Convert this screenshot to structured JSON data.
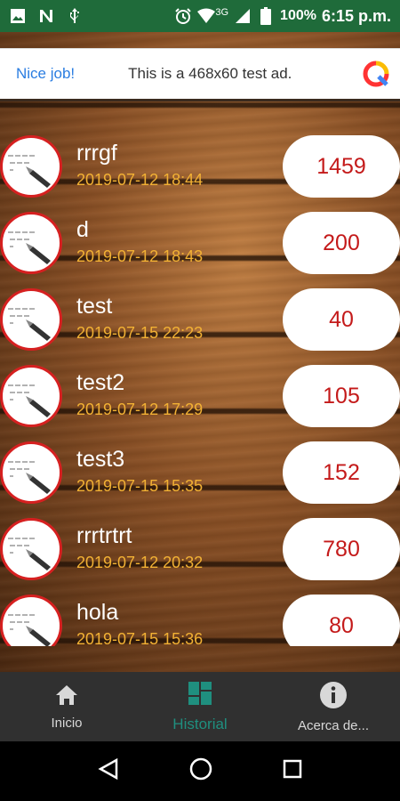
{
  "status_bar": {
    "network": "3G",
    "battery": "100%",
    "time": "6:15 p.m."
  },
  "ad": {
    "nice_label": "Nice job!",
    "text": "This is a 468x60 test ad."
  },
  "history": [
    {
      "name": "rrrgf",
      "date": "2019-07-12 18:44",
      "score": "1459"
    },
    {
      "name": "d",
      "date": "2019-07-12 18:43",
      "score": "200"
    },
    {
      "name": "test",
      "date": "2019-07-15 22:23",
      "score": "40"
    },
    {
      "name": "test2",
      "date": "2019-07-12 17:29",
      "score": "105"
    },
    {
      "name": "test3",
      "date": "2019-07-15 15:35",
      "score": "152"
    },
    {
      "name": "rrrtrtrt",
      "date": "2019-07-12 20:32",
      "score": "780"
    },
    {
      "name": "hola",
      "date": "2019-07-15 15:36",
      "score": "80"
    }
  ],
  "bottom_nav": [
    {
      "label": "Inicio",
      "icon": "home-icon"
    },
    {
      "label": "Historial",
      "icon": "dashboard-icon",
      "active": true
    },
    {
      "label": "Acerca de...",
      "icon": "info-icon"
    }
  ],
  "colors": {
    "accent": "#1f8f7f",
    "score_text": "#c41a1a",
    "date_text": "#f2b134",
    "status_bar": "#1f6b3a"
  }
}
